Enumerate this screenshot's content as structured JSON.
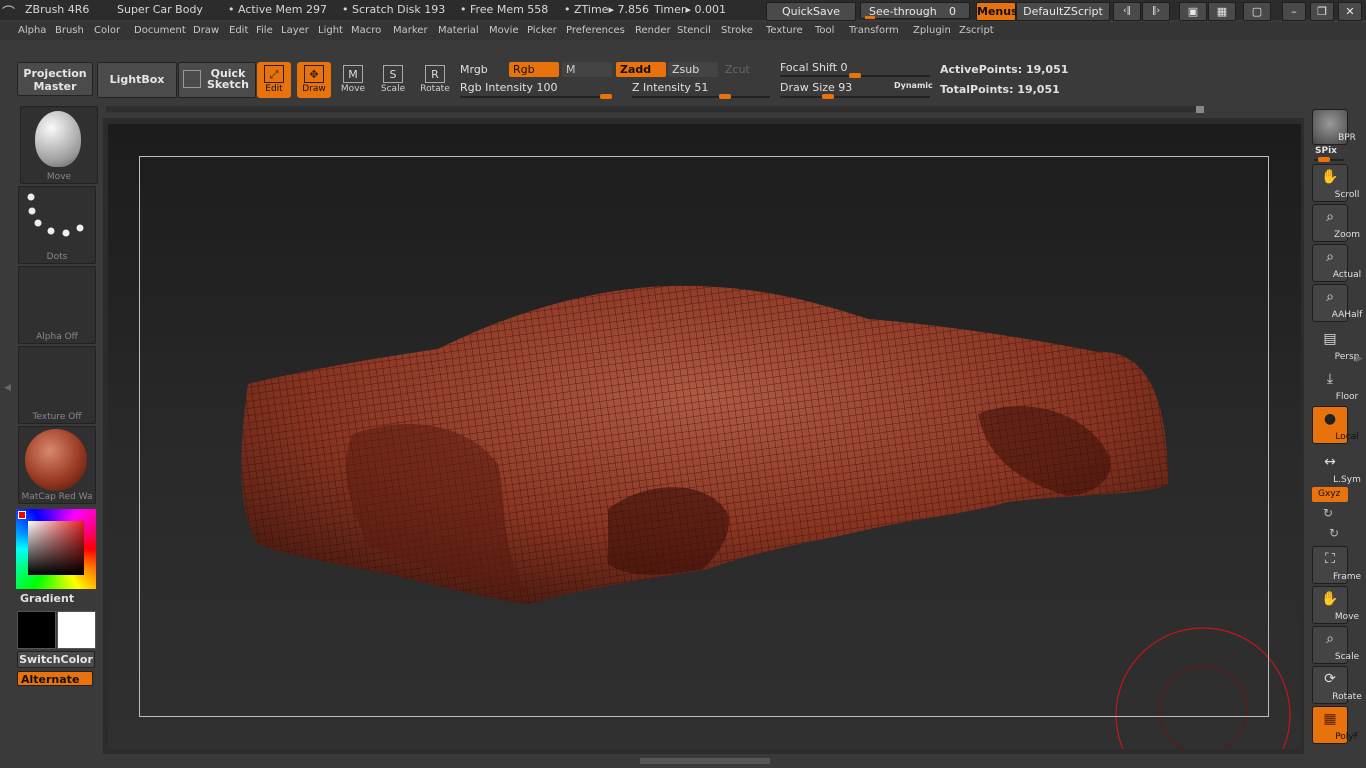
{
  "titlebar": {
    "app": "ZBrush 4R6",
    "doc": "Super Car Body",
    "active_mem": "• Active Mem 297",
    "scratch": "• Scratch Disk 193",
    "free_mem": "• Free Mem 558",
    "ztime": "• ZTime▸ 7.856",
    "timer": "Timer▸ 0.001",
    "quicksave": "QuickSave",
    "see_through": "See-through",
    "see_through_val": "0",
    "menus": "Menus",
    "script": "DefaultZScript"
  },
  "menu": [
    "Alpha",
    "Brush",
    "Color",
    "Document",
    "Draw",
    "Edit",
    "File",
    "Layer",
    "Light",
    "Macro",
    "Marker",
    "Material",
    "Movie",
    "Picker",
    "Preferences",
    "Render",
    "Stencil",
    "Stroke",
    "Texture",
    "Tool",
    "Transform",
    "Zplugin",
    "Zscript"
  ],
  "shelf": {
    "projection_master": "Projection Master",
    "lightbox": "LightBox",
    "quick_sketch": "Quick Sketch",
    "edit": "Edit",
    "draw": "Draw",
    "move": "Move",
    "scale": "Scale",
    "rotate": "Rotate",
    "mrgb": "Mrgb",
    "rgb": "Rgb",
    "m": "M",
    "zadd": "Zadd",
    "zsub": "Zsub",
    "zcut": "Zcut",
    "rgb_intensity": "Rgb Intensity 100",
    "z_intensity": "Z Intensity 51",
    "focal_shift": "Focal Shift 0",
    "draw_size": "Draw Size 93",
    "dynamic": "Dynamic",
    "active_points": "ActivePoints: 19,051",
    "total_points": "TotalPoints: 19,051"
  },
  "left": {
    "brush": "Move",
    "stroke": "Dots",
    "alpha": "Alpha Off",
    "texture": "Texture Off",
    "material": "MatCap Red Wa",
    "gradient": "Gradient",
    "switch_color": "SwitchColor",
    "alternate": "Alternate"
  },
  "right": {
    "bpr": "BPR",
    "spix": "SPix",
    "scroll": "Scroll",
    "zoom": "Zoom",
    "actual": "Actual",
    "aahalf": "AAHalf",
    "persp": "Persp",
    "floor": "Floor",
    "local": "Local",
    "lsym": "L.Sym",
    "xyz": "Gxyz",
    "frame": "Frame",
    "move": "Move",
    "scale": "Scale",
    "rotate": "Rotate",
    "polyf": "PolyF"
  },
  "colors": {
    "accent": "#e8720c",
    "model": "#8a3522"
  }
}
